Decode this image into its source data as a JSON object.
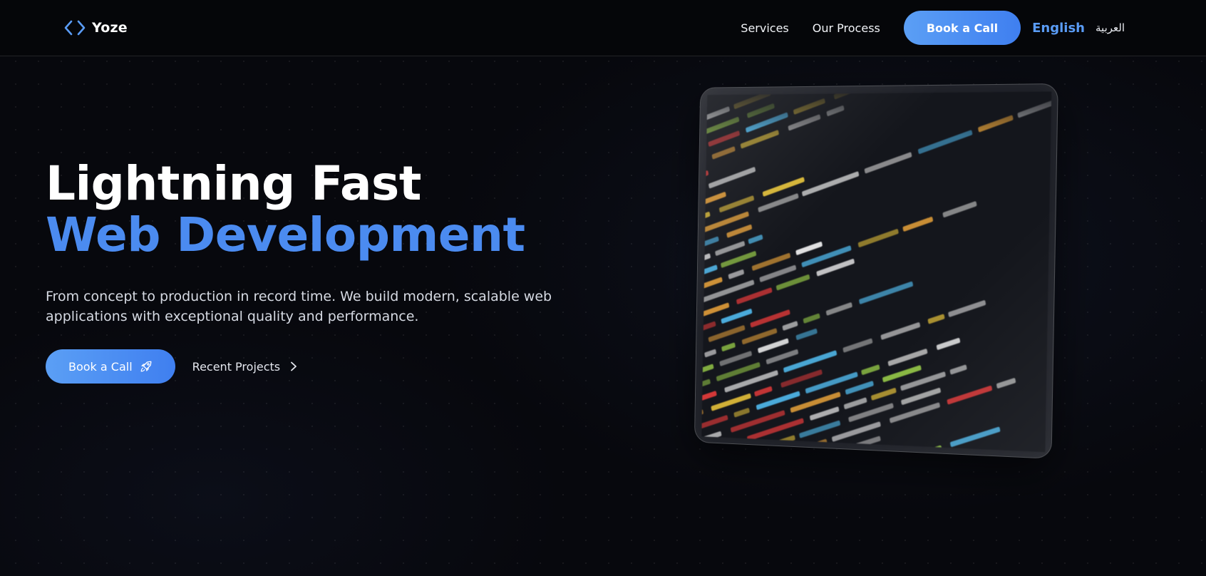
{
  "brand": {
    "name": "Yoze",
    "icon": "code-brackets-icon",
    "accent": "#5a9cf6"
  },
  "nav": {
    "links": [
      "Services",
      "Our Process"
    ],
    "cta_label": "Book a Call",
    "languages": {
      "english": "English",
      "arabic": "العربية"
    }
  },
  "hero": {
    "title_line1": "Lightning Fast",
    "title_line2": "Web Development",
    "subtitle_line1": "From concept to production in record time. We build modern, scalable web",
    "subtitle_line2": "applications with exceptional quality and performance.",
    "primary_cta": {
      "label": "Book a Call",
      "icon": "rocket-icon"
    },
    "secondary_cta": {
      "label": "Recent Projects",
      "icon": "chevron-right-icon"
    }
  },
  "media": {
    "description_icon": "code-screenshot-image"
  },
  "colors": {
    "background": "#07080d",
    "primary": "#4b8bf0",
    "button_gradient_start": "#5b9ff5",
    "button_gradient_end": "#3f7ff0"
  }
}
